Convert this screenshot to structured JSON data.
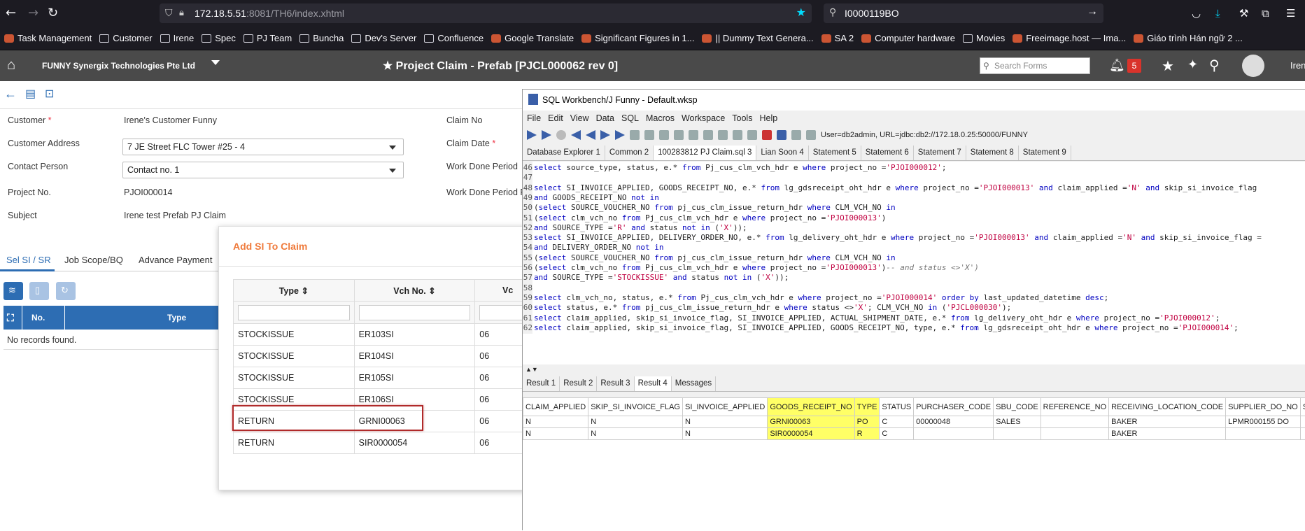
{
  "browser": {
    "url_host": "172.18.5.51",
    "url_rest": ":8081/TH6/index.xhtml",
    "search_text": "I0000119BO",
    "bookmarks": [
      "Task Management",
      "Customer",
      "Irene",
      "Spec",
      "PJ Team",
      "Buncha",
      "Dev's Server",
      "Confluence",
      "Google Translate",
      "Significant Figures in 1...",
      "|| Dummy Text Genera...",
      "SA 2",
      "Computer hardware",
      "Movies",
      "Freeimage.host — Ima...",
      "Giáo trình Hán ngữ 2 ..."
    ]
  },
  "app": {
    "company": "FUNNY Synergix Technologies Pte Ltd",
    "title": "Project Claim - Prefab [PJCL000062 rev 0]",
    "search_placeholder": "Search Forms",
    "notification_count": "5",
    "user": "Irene"
  },
  "form": {
    "customer_label": "Customer",
    "customer_value": "Irene's Customer Funny",
    "address_label": "Customer Address",
    "address_value": "7 JE Street FLC Tower #25 - 4",
    "contact_label": "Contact Person",
    "contact_value": "Contact no. 1",
    "project_label": "Project No.",
    "project_value": "PJOI000014",
    "subject_label": "Subject",
    "subject_value": "Irene test Prefab PJ Claim",
    "claim_no_label": "Claim No",
    "claim_date_label": "Claim Date",
    "work_done_label": "Work Done Period",
    "work_done_r_label": "Work Done Period R"
  },
  "tabs": [
    "Sel SI / SR",
    "Job Scope/BQ",
    "Advance Payment"
  ],
  "grid": {
    "col_no": "No.",
    "col_type": "Type",
    "empty": "No records found."
  },
  "dialog": {
    "title": "Add SI To Claim",
    "col_type": "Type",
    "col_vch": "Vch No.",
    "col_v": "Vc",
    "rows": [
      {
        "type": "STOCKISSUE",
        "vch": "ER103SI",
        "v": "06"
      },
      {
        "type": "STOCKISSUE",
        "vch": "ER104SI",
        "v": "06"
      },
      {
        "type": "STOCKISSUE",
        "vch": "ER105SI",
        "v": "06"
      },
      {
        "type": "STOCKISSUE",
        "vch": "ER106SI",
        "v": "06"
      },
      {
        "type": "RETURN",
        "vch": "GRNI00063",
        "v": "06"
      },
      {
        "type": "RETURN",
        "vch": "SIR0000054",
        "v": "06"
      }
    ]
  },
  "workbench": {
    "title": "SQL Workbench/J Funny - Default.wksp",
    "menu": [
      "File",
      "Edit",
      "View",
      "Data",
      "SQL",
      "Macros",
      "Workspace",
      "Tools",
      "Help"
    ],
    "connection": "User=db2admin, URL=jdbc:db2://172.18.0.25:50000/FUNNY",
    "tabs": [
      "Database Explorer 1",
      "Common 2",
      "100283812 PJ Claim.sql 3",
      "Lian Soon 4",
      "Statement 5",
      "Statement 6",
      "Statement 7",
      "Statement 8",
      "Statement 9"
    ],
    "result_tabs": [
      "Result 1",
      "Result 2",
      "Result 3",
      "Result 4",
      "Messages"
    ],
    "result_columns": [
      "CLAIM_APPLIED",
      "SKIP_SI_INVOICE_FLAG",
      "SI_INVOICE_APPLIED",
      "GOODS_RECEIPT_NO",
      "TYPE",
      "STATUS",
      "PURCHASER_CODE",
      "SBU_CODE",
      "REFERENCE_NO",
      "RECEIVING_LOCATION_CODE",
      "SUPPLIER_DO_NO",
      "S"
    ],
    "result_rows": [
      [
        "N",
        "N",
        "N",
        "GRNI00063",
        "PO",
        "C",
        "00000048",
        "SALES",
        "",
        "BAKER",
        "LPMR000155 DO",
        ""
      ],
      [
        "N",
        "N",
        "N",
        "SIR0000054",
        "R",
        "C",
        "",
        "",
        "",
        "BAKER",
        "",
        ""
      ]
    ],
    "lines": [
      {
        "n": "46",
        "segs": [
          [
            "kw",
            "select "
          ],
          [
            "",
            "source_type, status, e.* "
          ],
          [
            "kw",
            "from "
          ],
          [
            "",
            "Pj_cus_clm_vch_hdr e "
          ],
          [
            "kw",
            "where "
          ],
          [
            "",
            "project_no ="
          ],
          [
            "st",
            "'PJOI000012'"
          ],
          [
            "",
            ";"
          ]
        ]
      },
      {
        "n": "47",
        "segs": []
      },
      {
        "n": "48",
        "segs": [
          [
            "kw",
            "select "
          ],
          [
            "",
            "SI_INVOICE_APPLIED, GOODS_RECEIPT_NO, e.* "
          ],
          [
            "kw",
            "from "
          ],
          [
            "",
            "lg_gdsreceipt_oht_hdr e "
          ],
          [
            "kw",
            "where "
          ],
          [
            "",
            "project_no ="
          ],
          [
            "st",
            "'PJOI000013'"
          ],
          [
            "kw",
            " and "
          ],
          [
            "",
            "claim_applied ="
          ],
          [
            "st",
            "'N'"
          ],
          [
            "kw",
            " and "
          ],
          [
            "",
            "skip_si_invoice_flag"
          ]
        ]
      },
      {
        "n": "49",
        "segs": [
          [
            "kw",
            "and "
          ],
          [
            "",
            "GOODS_RECEIPT_NO "
          ],
          [
            "kw",
            "not in"
          ]
        ]
      },
      {
        "n": "50",
        "segs": [
          [
            "",
            "("
          ],
          [
            "kw",
            "select "
          ],
          [
            "",
            "SOURCE_VOUCHER_NO "
          ],
          [
            "kw",
            "from "
          ],
          [
            "",
            "pj_cus_clm_issue_return_hdr "
          ],
          [
            "kw",
            "where "
          ],
          [
            "",
            "CLM_VCH_NO "
          ],
          [
            "kw",
            "in"
          ]
        ]
      },
      {
        "n": "51",
        "segs": [
          [
            "",
            "("
          ],
          [
            "kw",
            "select "
          ],
          [
            "",
            "clm_vch_no "
          ],
          [
            "kw",
            "from "
          ],
          [
            "",
            "Pj_cus_clm_vch_hdr e "
          ],
          [
            "kw",
            "where "
          ],
          [
            "",
            "project_no ="
          ],
          [
            "st",
            "'PJOI000013'"
          ],
          [
            "",
            ")"
          ]
        ]
      },
      {
        "n": "52",
        "segs": [
          [
            "kw",
            "and "
          ],
          [
            "",
            "SOURCE_TYPE ="
          ],
          [
            "st",
            "'R'"
          ],
          [
            "kw",
            " and "
          ],
          [
            "",
            "status "
          ],
          [
            "kw",
            "not in "
          ],
          [
            "",
            "("
          ],
          [
            "st",
            "'X'"
          ],
          [
            "",
            "));"
          ]
        ]
      },
      {
        "n": "53",
        "segs": [
          [
            "kw",
            "select "
          ],
          [
            "",
            "SI_INVOICE_APPLIED, DELIVERY_ORDER_NO, e.* "
          ],
          [
            "kw",
            "from "
          ],
          [
            "",
            "lg_delivery_oht_hdr e "
          ],
          [
            "kw",
            "where "
          ],
          [
            "",
            "project_no ="
          ],
          [
            "st",
            "'PJOI000013'"
          ],
          [
            "kw",
            " and "
          ],
          [
            "",
            "claim_applied ="
          ],
          [
            "st",
            "'N'"
          ],
          [
            "kw",
            " and "
          ],
          [
            "",
            "skip_si_invoice_flag ="
          ]
        ]
      },
      {
        "n": "54",
        "segs": [
          [
            "kw",
            "and "
          ],
          [
            "",
            "DELIVERY_ORDER_NO "
          ],
          [
            "kw",
            "not in"
          ]
        ]
      },
      {
        "n": "55",
        "segs": [
          [
            "",
            "("
          ],
          [
            "kw",
            "select "
          ],
          [
            "",
            "SOURCE_VOUCHER_NO "
          ],
          [
            "kw",
            "from "
          ],
          [
            "",
            "pj_cus_clm_issue_return_hdr "
          ],
          [
            "kw",
            "where "
          ],
          [
            "",
            "CLM_VCH_NO "
          ],
          [
            "kw",
            "in"
          ]
        ]
      },
      {
        "n": "56",
        "segs": [
          [
            "",
            "("
          ],
          [
            "kw",
            "select "
          ],
          [
            "",
            "clm_vch_no "
          ],
          [
            "kw",
            "from "
          ],
          [
            "",
            "Pj_cus_clm_vch_hdr e "
          ],
          [
            "kw",
            "where "
          ],
          [
            "",
            "project_no ="
          ],
          [
            "st",
            "'PJOI000013'"
          ],
          [
            "",
            ")"
          ],
          [
            "cm",
            "-- and status <>'X')"
          ]
        ]
      },
      {
        "n": "57",
        "segs": [
          [
            "kw",
            "and "
          ],
          [
            "",
            "SOURCE_TYPE ="
          ],
          [
            "st",
            "'STOCKISSUE'"
          ],
          [
            "kw",
            " and "
          ],
          [
            "",
            "status "
          ],
          [
            "kw",
            "not in "
          ],
          [
            "",
            "("
          ],
          [
            "st",
            "'X'"
          ],
          [
            "",
            "));"
          ]
        ]
      },
      {
        "n": "58",
        "segs": []
      },
      {
        "n": "59",
        "segs": [
          [
            "kw",
            "select "
          ],
          [
            "",
            "clm_vch_no, status, e.* "
          ],
          [
            "kw",
            "from "
          ],
          [
            "",
            "Pj_cus_clm_vch_hdr e "
          ],
          [
            "kw",
            "where "
          ],
          [
            "",
            "project_no ="
          ],
          [
            "st",
            "'PJOI000014'"
          ],
          [
            "kw",
            " order by "
          ],
          [
            "",
            "last_updated_datetime "
          ],
          [
            "kw",
            "desc"
          ],
          [
            "",
            ";"
          ]
        ]
      },
      {
        "n": "60",
        "segs": [
          [
            "kw",
            "select "
          ],
          [
            "",
            "status, e.* "
          ],
          [
            "kw",
            "from "
          ],
          [
            "",
            "pj_cus_clm_issue_return_hdr e "
          ],
          [
            "kw",
            "where "
          ],
          [
            "",
            "status <>"
          ],
          [
            "st",
            "'X'"
          ],
          [
            "",
            "; CLM_VCH_NO "
          ],
          [
            "kw",
            "in "
          ],
          [
            "",
            "("
          ],
          [
            "st",
            "'PJCL000030'"
          ],
          [
            "",
            ");"
          ]
        ]
      },
      {
        "n": "61",
        "segs": [
          [
            "kw",
            "select "
          ],
          [
            "",
            "claim_applied, skip_si_invoice_flag, SI_INVOICE_APPLIED, ACTUAL_SHIPMENT_DATE, e.* "
          ],
          [
            "kw",
            "from "
          ],
          [
            "",
            "lg_delivery_oht_hdr e "
          ],
          [
            "kw",
            "where "
          ],
          [
            "",
            "project_no ="
          ],
          [
            "st",
            "'PJOI000012'"
          ],
          [
            "",
            ";"
          ]
        ]
      },
      {
        "n": "62",
        "segs": [
          [
            "kw",
            "select "
          ],
          [
            "",
            "claim_applied, skip_si_invoice_flag, SI_INVOICE_APPLIED, GOODS_RECEIPT_NO, type, e.* "
          ],
          [
            "kw",
            "from "
          ],
          [
            "",
            "lg_gdsreceipt_oht_hdr e "
          ],
          [
            "kw",
            "where "
          ],
          [
            "",
            "project_no ="
          ],
          [
            "st",
            "'PJOI000014'"
          ],
          [
            "",
            ";"
          ]
        ]
      }
    ]
  }
}
